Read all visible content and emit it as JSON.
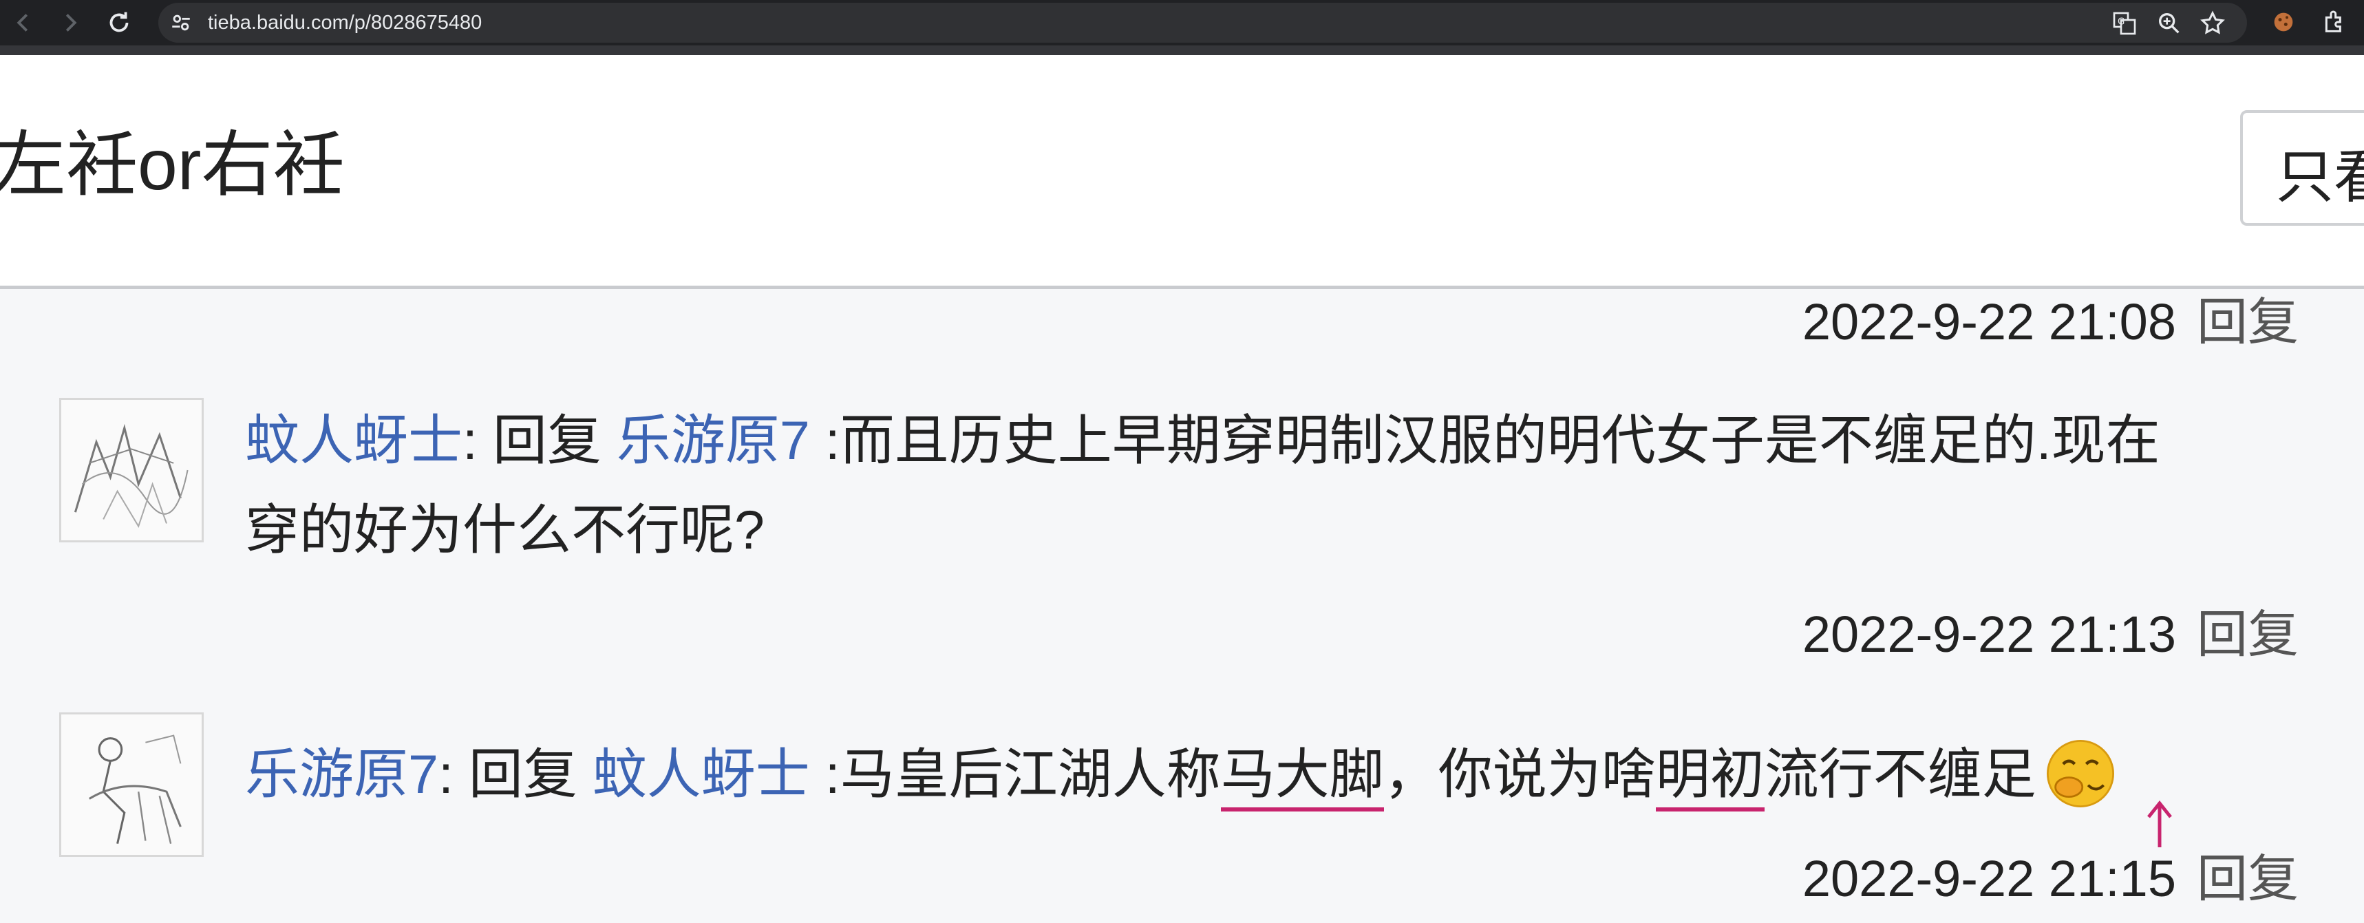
{
  "browser": {
    "url": "tieba.baidu.com/p/8028675480",
    "icons": [
      "back-icon",
      "forward-icon",
      "reload-icon",
      "site-info-icon",
      "translate-icon",
      "zoom-icon",
      "bookmark-star-icon",
      "cookie-extension-icon",
      "extensions-icon"
    ]
  },
  "header": {
    "title": "左衽or右衽",
    "only_button_label": "只看"
  },
  "replies": [
    {
      "time": "2022-9-22 21:08",
      "reply_label": "回复"
    },
    {
      "author": "蚊人蚜士",
      "sep": ": ",
      "reply_word": "回复 ",
      "target": "乐游原7",
      "text_line1": " :而且历史上早期穿明制汉服的明代女子是不缠足的.现在",
      "text_line2": "穿的好为什么不行呢?",
      "time": "2022-9-22 21:13",
      "reply_label": "回复"
    },
    {
      "author": "乐游原7",
      "sep": ": ",
      "reply_word": "回复 ",
      "target": "蚊人蚜士",
      "text_a": " :马皇后江湖人称",
      "text_mark1": "马大脚",
      "text_b": "，你说为啥",
      "text_mark2": "明初",
      "text_c": "流行不缠足",
      "emoji": "laughing-face-emoji",
      "time": "2022-9-22 21:15",
      "reply_label": "回复"
    }
  ],
  "colors": {
    "link": "#3c64b4",
    "annotation": "#c8246e",
    "page_bg": "#f6f7f9"
  }
}
